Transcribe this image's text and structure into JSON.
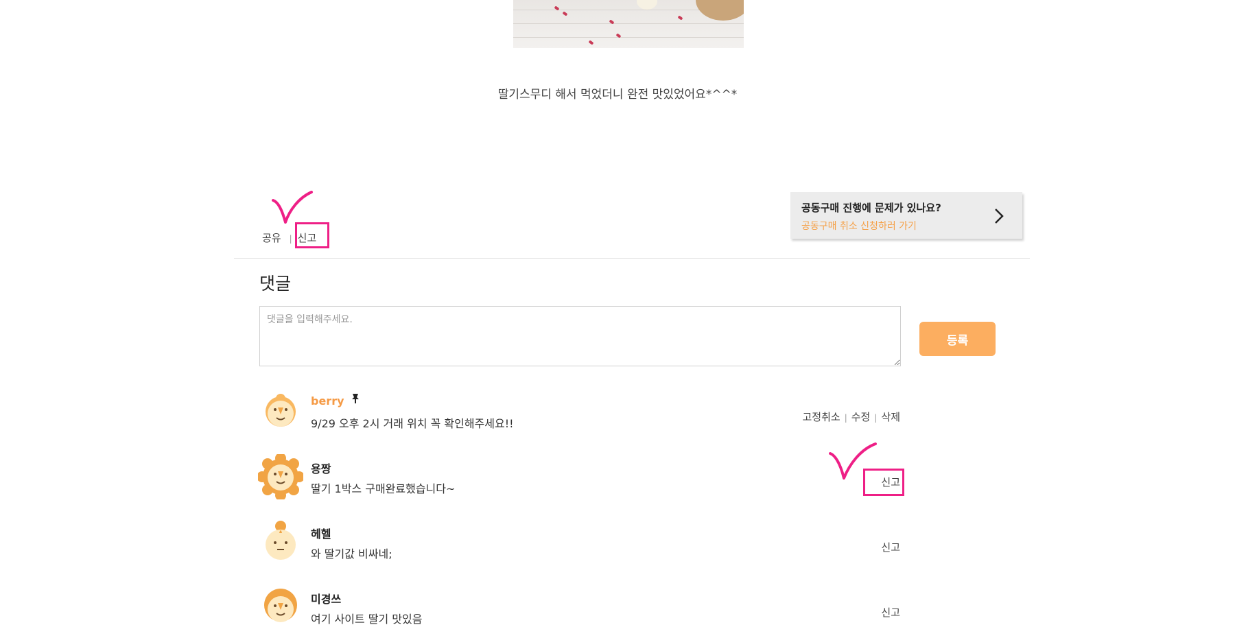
{
  "post": {
    "caption": "딸기스무디 해서 먹었더니 완전 맛있었어요*^^*"
  },
  "actions": {
    "share": "공유",
    "separator": "|",
    "report": "신고"
  },
  "banner": {
    "question": "공동구매 진행에 문제가 있나요?",
    "link": "공동구매 취소 신청하러 가기",
    "chevron_icon": "chevron-right-icon"
  },
  "comments": {
    "title": "댓글",
    "input_placeholder": "댓글을 입력해주세요.",
    "submit_label": "등록",
    "items": [
      {
        "author": "berry",
        "is_owner": true,
        "pinned": true,
        "pin_icon": "pin-icon",
        "text": "9/29 오후 2시 거래 위치 꼭 확인해주세요!!",
        "actions": [
          "고정취소",
          "수정",
          "삭제"
        ]
      },
      {
        "author": "용짱",
        "text": "딸기 1박스 구매완료했습니다~",
        "report": "신고"
      },
      {
        "author": "헤헬",
        "text": "와 딸기값 비싸네;",
        "report": "신고"
      },
      {
        "author": "미경쓰",
        "text": "여기 사이트 딸기 맛있음",
        "report": "신고"
      }
    ]
  },
  "colors": {
    "accent_orange": "#fcae60",
    "owner_name": "#f59a45",
    "highlight_pink": "#ee1f86"
  }
}
